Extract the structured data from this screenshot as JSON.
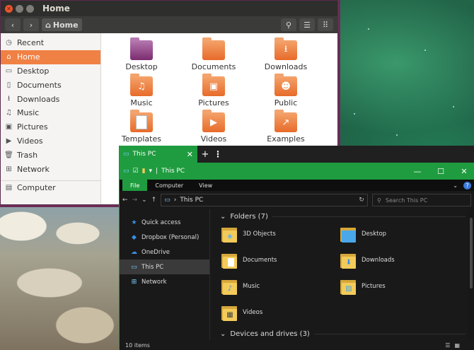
{
  "nautilus": {
    "title": "Home",
    "path_button": "Home",
    "sidebar": [
      {
        "label": "Recent",
        "icon": "clock-icon"
      },
      {
        "label": "Home",
        "icon": "home-icon",
        "active": true
      },
      {
        "label": "Desktop",
        "icon": "desktop-icon"
      },
      {
        "label": "Documents",
        "icon": "document-icon"
      },
      {
        "label": "Downloads",
        "icon": "download-icon"
      },
      {
        "label": "Music",
        "icon": "music-icon"
      },
      {
        "label": "Pictures",
        "icon": "picture-icon"
      },
      {
        "label": "Videos",
        "icon": "video-icon"
      },
      {
        "label": "Trash",
        "icon": "trash-icon"
      },
      {
        "label": "Network",
        "icon": "network-icon"
      },
      {
        "label": "Computer",
        "icon": "drive-icon"
      }
    ],
    "folders": [
      {
        "label": "Desktop",
        "icon": "desktop-folder-icon"
      },
      {
        "label": "Documents",
        "icon": "documents-folder-icon"
      },
      {
        "label": "Downloads",
        "icon": "downloads-folder-icon"
      },
      {
        "label": "Music",
        "icon": "music-folder-icon"
      },
      {
        "label": "Pictures",
        "icon": "pictures-folder-icon"
      },
      {
        "label": "Public",
        "icon": "public-folder-icon"
      },
      {
        "label": "Templates",
        "icon": "templates-folder-icon"
      },
      {
        "label": "Videos",
        "icon": "videos-folder-icon"
      },
      {
        "label": "Examples",
        "icon": "examples-folder-icon"
      }
    ],
    "accent_color": "#f08145"
  },
  "explorer": {
    "tab_title": "This PC",
    "window_title": "This PC",
    "ribbon": {
      "file": "File",
      "computer": "Computer",
      "view": "View"
    },
    "address": "This PC",
    "search_placeholder": "Search This PC",
    "nav": [
      {
        "label": "Quick access",
        "icon": "star-icon"
      },
      {
        "label": "Dropbox (Personal)",
        "icon": "dropbox-icon"
      },
      {
        "label": "OneDrive",
        "icon": "cloud-icon"
      },
      {
        "label": "This PC",
        "icon": "computer-icon",
        "active": true
      },
      {
        "label": "Network",
        "icon": "network-icon"
      }
    ],
    "folders_header": "Folders (7)",
    "folders": [
      {
        "label": "3D Objects",
        "icon": "3d-objects-icon"
      },
      {
        "label": "Desktop",
        "icon": "desktop-icon"
      },
      {
        "label": "Documents",
        "icon": "documents-icon"
      },
      {
        "label": "Downloads",
        "icon": "downloads-icon"
      },
      {
        "label": "Music",
        "icon": "music-icon"
      },
      {
        "label": "Pictures",
        "icon": "pictures-icon"
      },
      {
        "label": "Videos",
        "icon": "videos-icon"
      }
    ],
    "drives_header": "Devices and drives (3)",
    "status": "10 items",
    "accent_color": "#1f9c3f"
  }
}
